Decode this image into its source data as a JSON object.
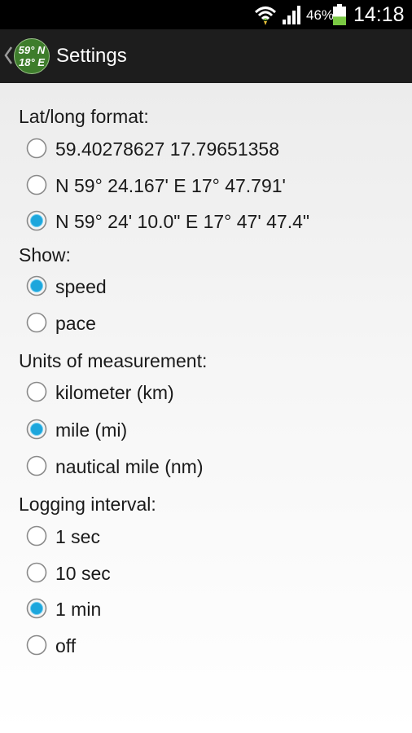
{
  "status_bar": {
    "battery_percent": "46%",
    "battery_level": 0.46,
    "time": "14:18",
    "icons": [
      "wifi-icon",
      "signal-icon",
      "battery-icon"
    ],
    "battery_color": "#7ac943"
  },
  "action_bar": {
    "title": "Settings",
    "logo_line1": "59° N",
    "logo_line2": "18° E",
    "logo_color": "#3e7d2c"
  },
  "accent_color": "#1da6dc",
  "groups": [
    {
      "title": "Lat/long format:",
      "options": [
        {
          "label": "59.40278627 17.79651358",
          "selected": false
        },
        {
          "label": "N 59° 24.167' E 17° 47.791'",
          "selected": false
        },
        {
          "label": "N 59° 24' 10.0\" E 17° 47' 47.4\"",
          "selected": true
        }
      ]
    },
    {
      "title": "Show:",
      "options": [
        {
          "label": "speed",
          "selected": true
        },
        {
          "label": "pace",
          "selected": false
        }
      ]
    },
    {
      "title": "Units of measurement:",
      "options": [
        {
          "label": "kilometer (km)",
          "selected": false
        },
        {
          "label": "mile (mi)",
          "selected": true
        },
        {
          "label": "nautical mile (nm)",
          "selected": false
        }
      ]
    },
    {
      "title": "Logging interval:",
      "options": [
        {
          "label": "1 sec",
          "selected": false
        },
        {
          "label": "10 sec",
          "selected": false
        },
        {
          "label": "1 min",
          "selected": true
        },
        {
          "label": "off",
          "selected": false
        }
      ]
    }
  ]
}
